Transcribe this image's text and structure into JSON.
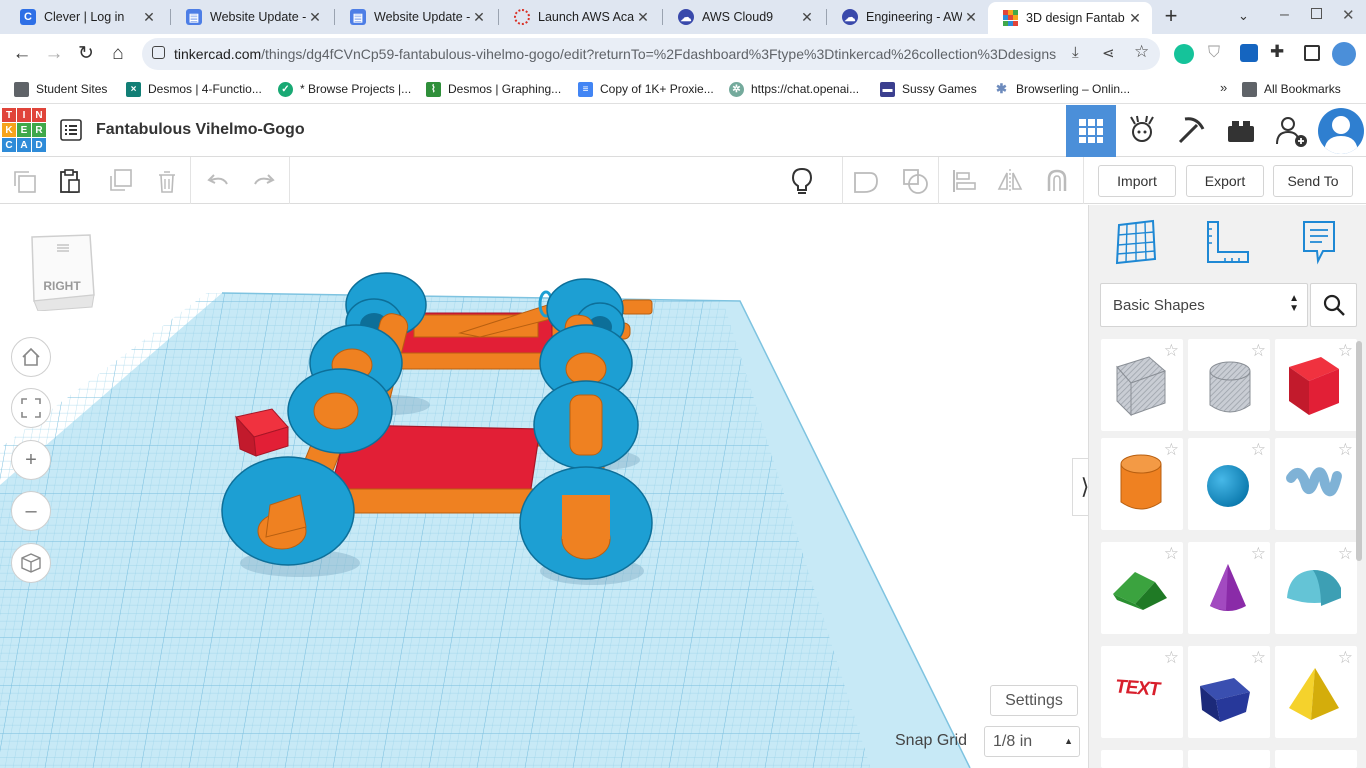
{
  "browser": {
    "tabs": [
      {
        "title": "Clever | Log in",
        "icon": "clever-icon",
        "color": "#2e6fe6"
      },
      {
        "title": "Website Update -",
        "icon": "google-sites-icon",
        "color": "#4d7ee6"
      },
      {
        "title": "Website Update -",
        "icon": "google-sites-icon",
        "color": "#4d7ee6"
      },
      {
        "title": "Launch AWS Aca",
        "icon": "loading-icon",
        "color": "#d93025"
      },
      {
        "title": "AWS Cloud9",
        "icon": "cloud-icon",
        "color": "#3949ab"
      },
      {
        "title": "Engineering - AW",
        "icon": "cloud-icon",
        "color": "#3949ab"
      },
      {
        "title": "3D design Fantab",
        "icon": "tinkercad-icon",
        "color": "#e0443a",
        "active": true
      }
    ],
    "url_host": "tinkercad.com",
    "url_path": "/things/dg4fCVnCp59-fantabulous-vihelmo-gogo/edit?returnTo=%2Fdashboard%3Ftype%3Dtinkercad%26collection%3Ddesigns",
    "bookmarks": [
      {
        "label": "Student Sites",
        "icon": "folder-icon"
      },
      {
        "label": "Desmos | 4-Functio...",
        "icon": "desmos-icon"
      },
      {
        "label": "* Browse Projects |...",
        "icon": "shield-icon"
      },
      {
        "label": "Desmos | Graphing...",
        "icon": "desmos-graph-icon"
      },
      {
        "label": "Copy of 1K+ Proxie...",
        "icon": "docs-icon"
      },
      {
        "label": "https://chat.openai...",
        "icon": "openai-icon"
      },
      {
        "label": "Sussy Games",
        "icon": "sites-icon"
      },
      {
        "label": "Browserling – Onlin...",
        "icon": "browserling-icon"
      }
    ],
    "all_bookmarks": "All Bookmarks"
  },
  "app": {
    "logo_letters": [
      "T",
      "I",
      "N",
      "K",
      "E",
      "R",
      "C",
      "A",
      "D"
    ],
    "design_title": "Fantabulous Vihelmo-Gogo",
    "import_label": "Import",
    "export_label": "Export",
    "send_to_label": "Send To"
  },
  "viewport": {
    "view_cube_label": "RIGHT",
    "settings_label": "Settings",
    "snap_grid_label": "Snap Grid",
    "snap_grid_value": "1/8 in"
  },
  "panel": {
    "shape_library": "Basic Shapes",
    "shapes": [
      {
        "name": "box-hole-shape"
      },
      {
        "name": "cylinder-hole-shape"
      },
      {
        "name": "box-shape"
      },
      {
        "name": "cylinder-shape"
      },
      {
        "name": "sphere-shape"
      },
      {
        "name": "scribble-shape"
      },
      {
        "name": "roof-shape"
      },
      {
        "name": "cone-shape"
      },
      {
        "name": "round-roof-shape"
      },
      {
        "name": "text-shape",
        "text": "TEXT"
      },
      {
        "name": "half-sphere-shape"
      },
      {
        "name": "pyramid-shape"
      }
    ]
  },
  "colors": {
    "accent_blue": "#4b8fd9",
    "wheel_blue": "#1d9fd3",
    "axle_orange": "#ef8121",
    "body_red": "#e21f36",
    "grid_blue": "#a9dcef"
  }
}
